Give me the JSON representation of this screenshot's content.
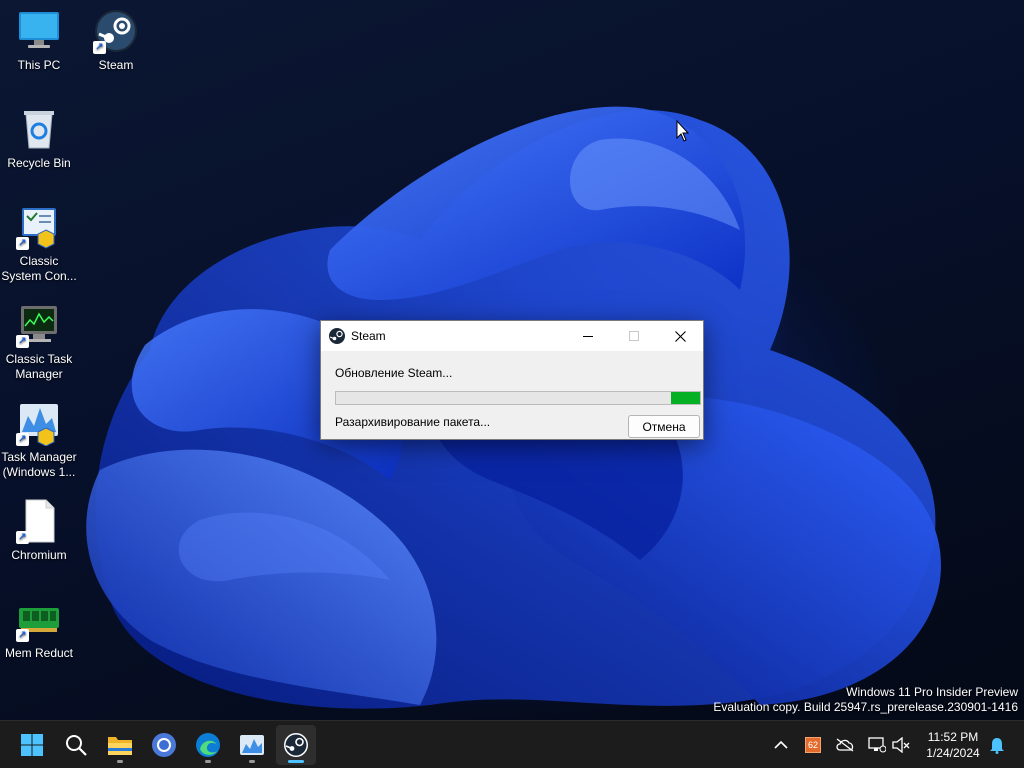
{
  "desktop": {
    "icons": [
      {
        "label": "This PC"
      },
      {
        "label": "Steam"
      },
      {
        "label": "Recycle Bin"
      },
      {
        "label": "Classic System Con..."
      },
      {
        "label": "Classic Task Manager"
      },
      {
        "label": "Task Manager (Windows 1..."
      },
      {
        "label": "Chromium"
      },
      {
        "label": "Mem Reduct"
      }
    ]
  },
  "watermark": {
    "line1": "Windows 11 Pro Insider Preview",
    "line2": "Evaluation copy. Build 25947.rs_prerelease.230901-1416"
  },
  "dialog": {
    "title": "Steam",
    "update_label": "Обновление Steam...",
    "status_label": "Разархивирование пакета...",
    "cancel_label": "Отмена",
    "progress_percent": 8,
    "progress_color": "#06b025"
  },
  "taskbar": {
    "apps": [
      "start-icon",
      "search-icon",
      "file-explorer-icon",
      "chromium-icon",
      "edge-icon",
      "task-manager-icon",
      "steam-icon"
    ],
    "tray": {
      "badge_text": "62"
    },
    "time": "11:52 PM",
    "date": "1/24/2024"
  }
}
